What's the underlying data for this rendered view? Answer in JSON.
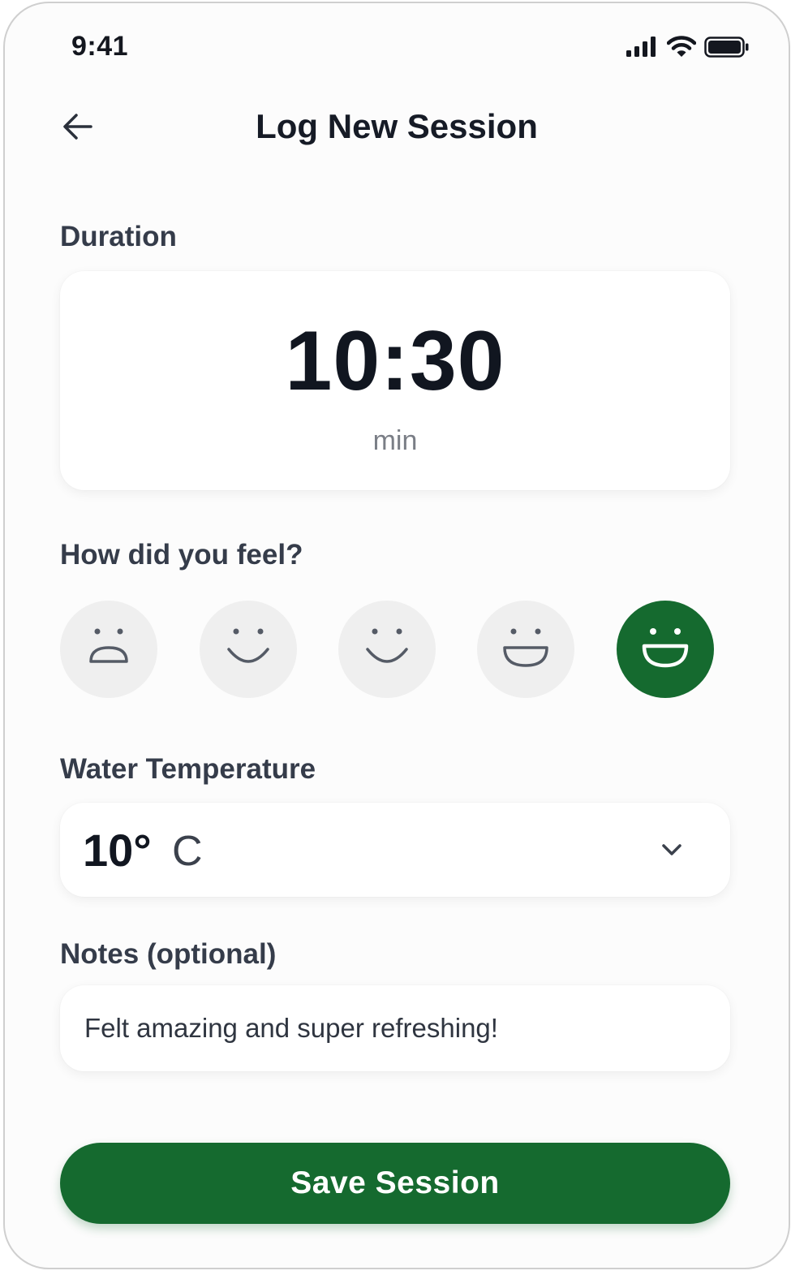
{
  "status_bar": {
    "time": "9:41",
    "icons": [
      "signal-icon",
      "wifi-icon",
      "battery-icon"
    ]
  },
  "header": {
    "title": "Log New Session",
    "back_icon": "arrow-left-icon"
  },
  "duration": {
    "label": "Duration",
    "value": "10:30",
    "unit": "min"
  },
  "feeling": {
    "label": "How did you feel?",
    "options": [
      "frown-icon",
      "smile-icon",
      "smile-icon",
      "grin-icon",
      "big-grin-icon"
    ],
    "selected_index": 4
  },
  "temperature": {
    "label": "Water Temperature",
    "value": "10°",
    "unit": "C",
    "dropdown_icon": "chevron-down-icon"
  },
  "notes": {
    "label": "Notes (optional)",
    "value": "Felt amazing and super refreshing!"
  },
  "save_button": {
    "label": "Save Session"
  },
  "colors": {
    "accent": "#156a2f",
    "mood_bg": "#efefef"
  }
}
